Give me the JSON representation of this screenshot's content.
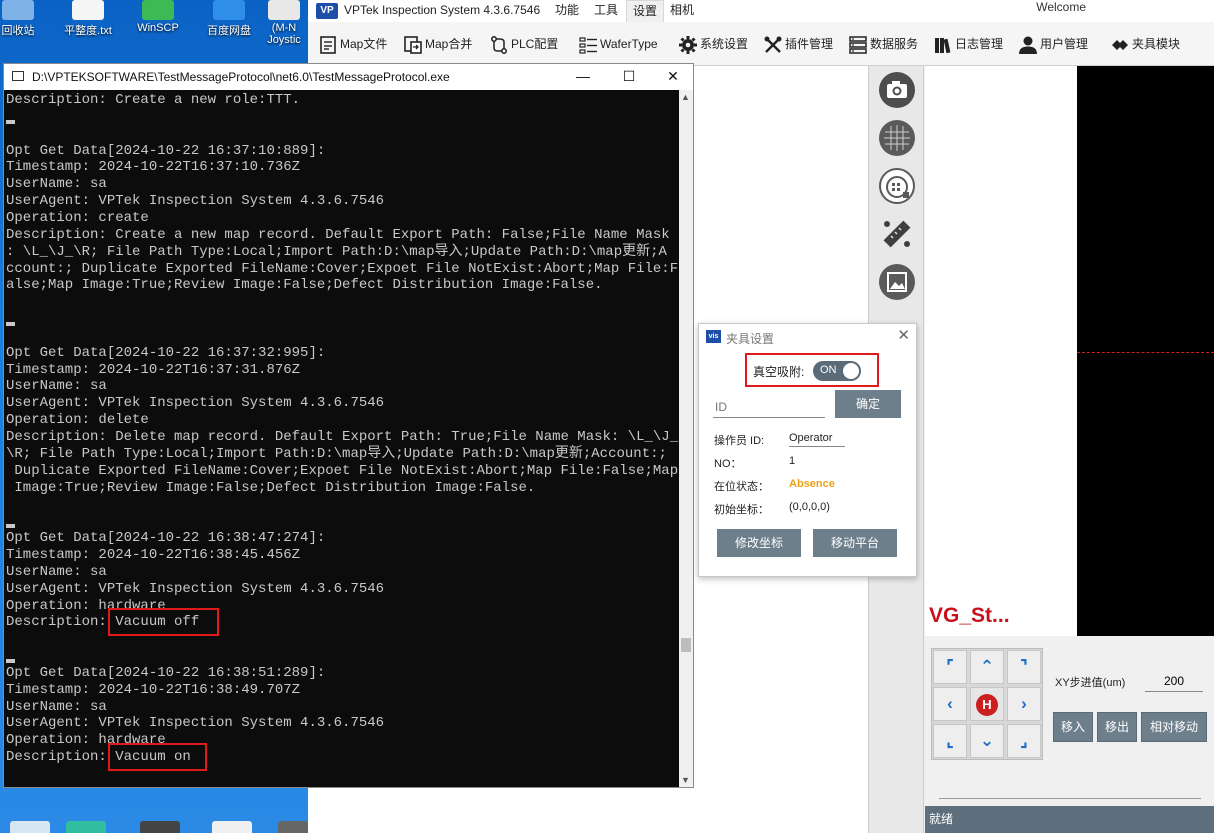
{
  "desktop": {
    "icons": [
      {
        "label": "回收站",
        "color": "#7fb3e8"
      },
      {
        "label": "平整度.txt",
        "color": "#f5f5f5"
      },
      {
        "label": "WinSCP",
        "color": "#3cba54"
      },
      {
        "label": "百度网盘",
        "color": "#2f8fe8"
      },
      {
        "label": "(M-N",
        "color": "#e8e8e8"
      }
    ],
    "partial_label": "Joystic"
  },
  "app": {
    "logo": "VP",
    "title": "VPTek Inspection System 4.3.6.7546",
    "menus": [
      "功能",
      "工具",
      "设置",
      "相机"
    ],
    "active_menu": "设置",
    "welcome": "Welcome",
    "toolbar": [
      {
        "label": "Map文件",
        "icon": "map-file-icon"
      },
      {
        "label": "Map合并",
        "icon": "map-merge-icon"
      },
      {
        "label": "PLC配置",
        "icon": "plc-icon"
      },
      {
        "label": "WaferType",
        "icon": "wafer-type-icon"
      },
      {
        "label": "系统设置",
        "icon": "gear-icon"
      },
      {
        "label": "插件管理",
        "icon": "plugin-tools-icon"
      },
      {
        "label": "数据服务",
        "icon": "server-icon"
      },
      {
        "label": "日志管理",
        "icon": "log-books-icon"
      },
      {
        "label": "用户管理",
        "icon": "user-icon"
      },
      {
        "label": "夹具模块",
        "icon": "fixture-icon"
      }
    ],
    "side_icons": [
      "camera-icon",
      "wafer-grid-icon",
      "wafer-map-icon",
      "measure-ruler-icon",
      "image-frame-icon"
    ],
    "preview_label": "VG_St...",
    "jog": {
      "buttons": [
        "⌜",
        "⌃",
        "⌝",
        "‹",
        "H",
        "›",
        "⌞",
        "⌄",
        "⌟"
      ],
      "step_label": "XY步进值(um)",
      "step_value": "200",
      "actions": [
        "移入",
        "移出",
        "相对移动"
      ]
    },
    "status": "就绪"
  },
  "console": {
    "title": "D:\\VPTEKSOFTWARE\\TestMessageProtocol\\net6.0\\TestMessageProtocol.exe",
    "lines": [
      "Description: Create a new role:TTT.",
      "",
      "",
      "Opt Get Data[2024-10-22 16:37:10:889]:",
      "Timestamp: 2024-10-22T16:37:10.736Z",
      "UserName: sa",
      "UserAgent: VPTek Inspection System 4.3.6.7546",
      "Operation: create",
      "Description: Create a new map record. Default Export Path: False;File Name Mask",
      ": \\L_\\J_\\R; File Path Type:Local;Import Path:D:\\map导入;Update Path:D:\\map更新;A",
      "ccount:; Duplicate Exported FileName:Cover;Expoet File NotExist:Abort;Map File:F",
      "alse;Map Image:True;Review Image:False;Defect Distribution Image:False.",
      "",
      "",
      "",
      "Opt Get Data[2024-10-22 16:37:32:995]:",
      "Timestamp: 2024-10-22T16:37:31.876Z",
      "UserName: sa",
      "UserAgent: VPTek Inspection System 4.3.6.7546",
      "Operation: delete",
      "Description: Delete map record. Default Export Path: True;File Name Mask: \\L_\\J_",
      "\\R; File Path Type:Local;Import Path:D:\\map导入;Update Path:D:\\map更新;Account:;",
      " Duplicate Exported FileName:Cover;Expoet File NotExist:Abort;Map File:False;Map",
      " Image:True;Review Image:False;Defect Distribution Image:False.",
      "",
      "",
      "Opt Get Data[2024-10-22 16:38:47:274]:",
      "Timestamp: 2024-10-22T16:38:45.456Z",
      "UserName: sa",
      "UserAgent: VPTek Inspection System 4.3.6.7546",
      "Operation: hardware",
      "Description: Vacuum off",
      "",
      "",
      "Opt Get Data[2024-10-22 16:38:51:289]:",
      "Timestamp: 2024-10-22T16:38:49.707Z",
      "UserName: sa",
      "UserAgent: VPTek Inspection System 4.3.6.7546",
      "Operation: hardware",
      "Description: Vacuum on"
    ]
  },
  "fixture_dialog": {
    "logo": "vis",
    "title": "夹具设置",
    "vacuum_label": "真空吸附:",
    "vacuum_state": "ON",
    "id_placeholder": "ID",
    "confirm": "确定",
    "rows": [
      {
        "label": "操作员 ID:",
        "value": "Operator"
      },
      {
        "label": "NO：",
        "value": "1"
      },
      {
        "label": "在位状态：",
        "value": "Absence"
      },
      {
        "label": "初始坐标：",
        "value": "(0,0,0,0)"
      }
    ],
    "buttons": [
      "修改坐标",
      "移动平台"
    ],
    "absence_color": "#e8a317"
  }
}
